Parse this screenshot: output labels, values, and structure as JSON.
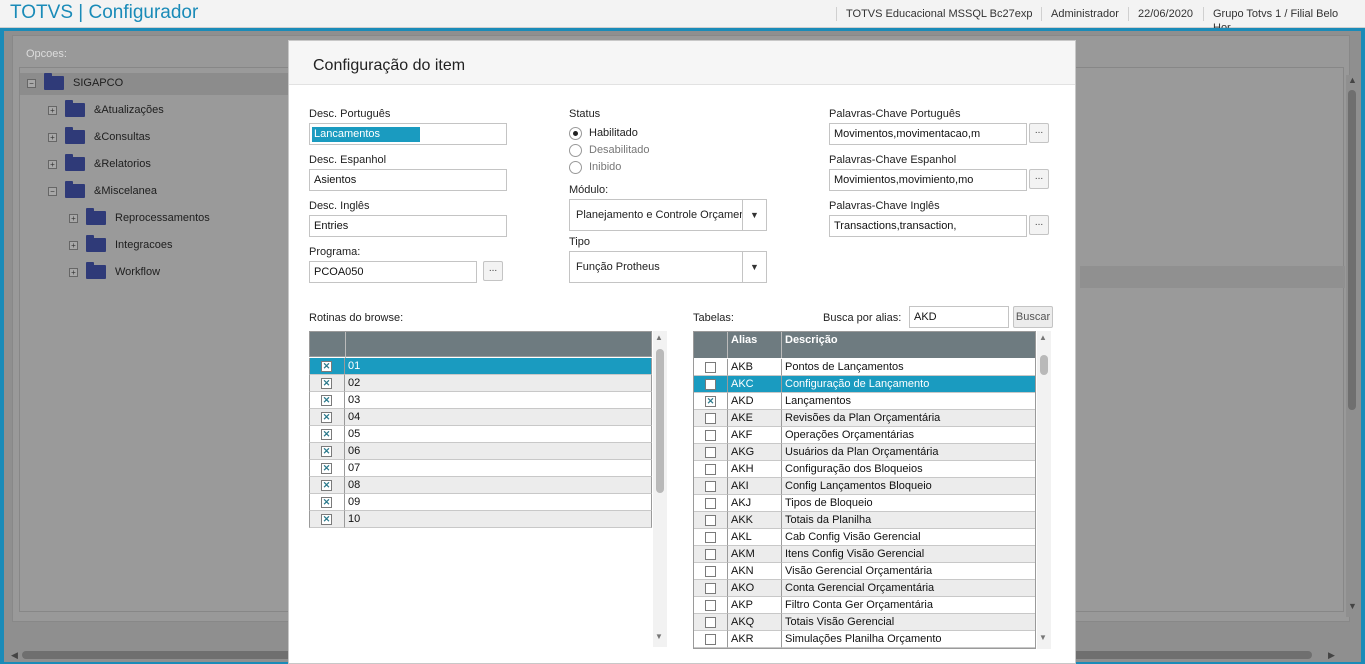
{
  "header": {
    "app_title": "TOTVS | Configurador",
    "environment": "TOTVS Educacional MSSQL Bc27exp",
    "user": "Administrador",
    "date": "22/06/2020",
    "company": "Grupo Totvs 1 / Filial Belo Hor"
  },
  "background": {
    "opcoes_label": "Opcoes:",
    "tree": [
      {
        "label": "SIGAPCO",
        "level": 0,
        "expander": "−"
      },
      {
        "label": "&Atualizações",
        "level": 1,
        "expander": "+"
      },
      {
        "label": "&Consultas",
        "level": 1,
        "expander": "+"
      },
      {
        "label": "&Relatorios",
        "level": 1,
        "expander": "+"
      },
      {
        "label": "&Miscelanea",
        "level": 1,
        "expander": "−"
      },
      {
        "label": "Reprocessamentos",
        "level": 2,
        "expander": "+"
      },
      {
        "label": "Integracoes",
        "level": 2,
        "expander": "+"
      },
      {
        "label": "Workflow",
        "level": 2,
        "expander": "+"
      }
    ]
  },
  "modal": {
    "title": "Configuração do item",
    "desc_pt_label": "Desc. Português",
    "desc_pt_value": "Lancamentos",
    "desc_es_label": "Desc. Espanhol",
    "desc_es_value": "Asientos",
    "desc_en_label": "Desc. Inglês",
    "desc_en_value": "Entries",
    "programa_label": "Programa:",
    "programa_value": "PCOA050",
    "dots": "...",
    "status_label": "Status",
    "status_options": [
      "Habilitado",
      "Desabilitado",
      "Inibido"
    ],
    "status_selected": "Habilitado",
    "modulo_label": "Módulo:",
    "modulo_value": "Planejamento e Controle Orçamentár",
    "tipo_label": "Tipo",
    "tipo_value": "Função Protheus",
    "kw_pt_label": "Palavras-Chave Português",
    "kw_pt_value": "Movimentos,movimentacao,m",
    "kw_es_label": "Palavras-Chave Espanhol",
    "kw_es_value": "Movimientos,movimiento,mo",
    "kw_en_label": "Palavras-Chave Inglês",
    "kw_en_value": "Transactions,transaction,",
    "rotinas_label": "Rotinas do browse:",
    "rotinas": [
      {
        "code": "01",
        "checked": true
      },
      {
        "code": "02",
        "checked": true
      },
      {
        "code": "03",
        "checked": true
      },
      {
        "code": "04",
        "checked": true
      },
      {
        "code": "05",
        "checked": true
      },
      {
        "code": "06",
        "checked": true
      },
      {
        "code": "07",
        "checked": true
      },
      {
        "code": "08",
        "checked": true
      },
      {
        "code": "09",
        "checked": true
      },
      {
        "code": "10",
        "checked": true
      }
    ],
    "rotinas_selected_index": 0,
    "tabelas_label": "Tabelas:",
    "busca_label": "Busca por alias:",
    "busca_value": "AKD",
    "buscar_button": "Buscar",
    "tabelas_columns": [
      "Alias",
      "Descrição"
    ],
    "tabelas": [
      {
        "alias": "AKB",
        "desc": "Pontos de Lançamentos",
        "checked": false
      },
      {
        "alias": "AKC",
        "desc": "Configuração de Lançamento",
        "checked": false
      },
      {
        "alias": "AKD",
        "desc": "Lançamentos",
        "checked": true
      },
      {
        "alias": "AKE",
        "desc": "Revisões da Plan Orçamentária",
        "checked": false
      },
      {
        "alias": "AKF",
        "desc": "Operações Orçamentárias",
        "checked": false
      },
      {
        "alias": "AKG",
        "desc": "Usuários da Plan Orçamentária",
        "checked": false
      },
      {
        "alias": "AKH",
        "desc": "Configuração dos Bloqueios",
        "checked": false
      },
      {
        "alias": "AKI",
        "desc": "Config Lançamentos Bloqueio",
        "checked": false
      },
      {
        "alias": "AKJ",
        "desc": "Tipos de Bloqueio",
        "checked": false
      },
      {
        "alias": "AKK",
        "desc": "Totais da Planilha",
        "checked": false
      },
      {
        "alias": "AKL",
        "desc": "Cab Config Visão Gerencial",
        "checked": false
      },
      {
        "alias": "AKM",
        "desc": "Itens Config Visão Gerencial",
        "checked": false
      },
      {
        "alias": "AKN",
        "desc": "Visão Gerencial Orçamentária",
        "checked": false
      },
      {
        "alias": "AKO",
        "desc": "Conta Gerencial Orçamentária",
        "checked": false
      },
      {
        "alias": "AKP",
        "desc": "Filtro Conta Ger Orçamentária",
        "checked": false
      },
      {
        "alias": "AKQ",
        "desc": "Totais Visão Gerencial",
        "checked": false
      },
      {
        "alias": "AKR",
        "desc": "Simulações Planilha Orçamento",
        "checked": false
      }
    ],
    "tabelas_selected_index": 1
  },
  "colors": {
    "brand": "#1a8bb8",
    "selection": "#1a9bc0",
    "grid_header": "#6e7b80"
  }
}
